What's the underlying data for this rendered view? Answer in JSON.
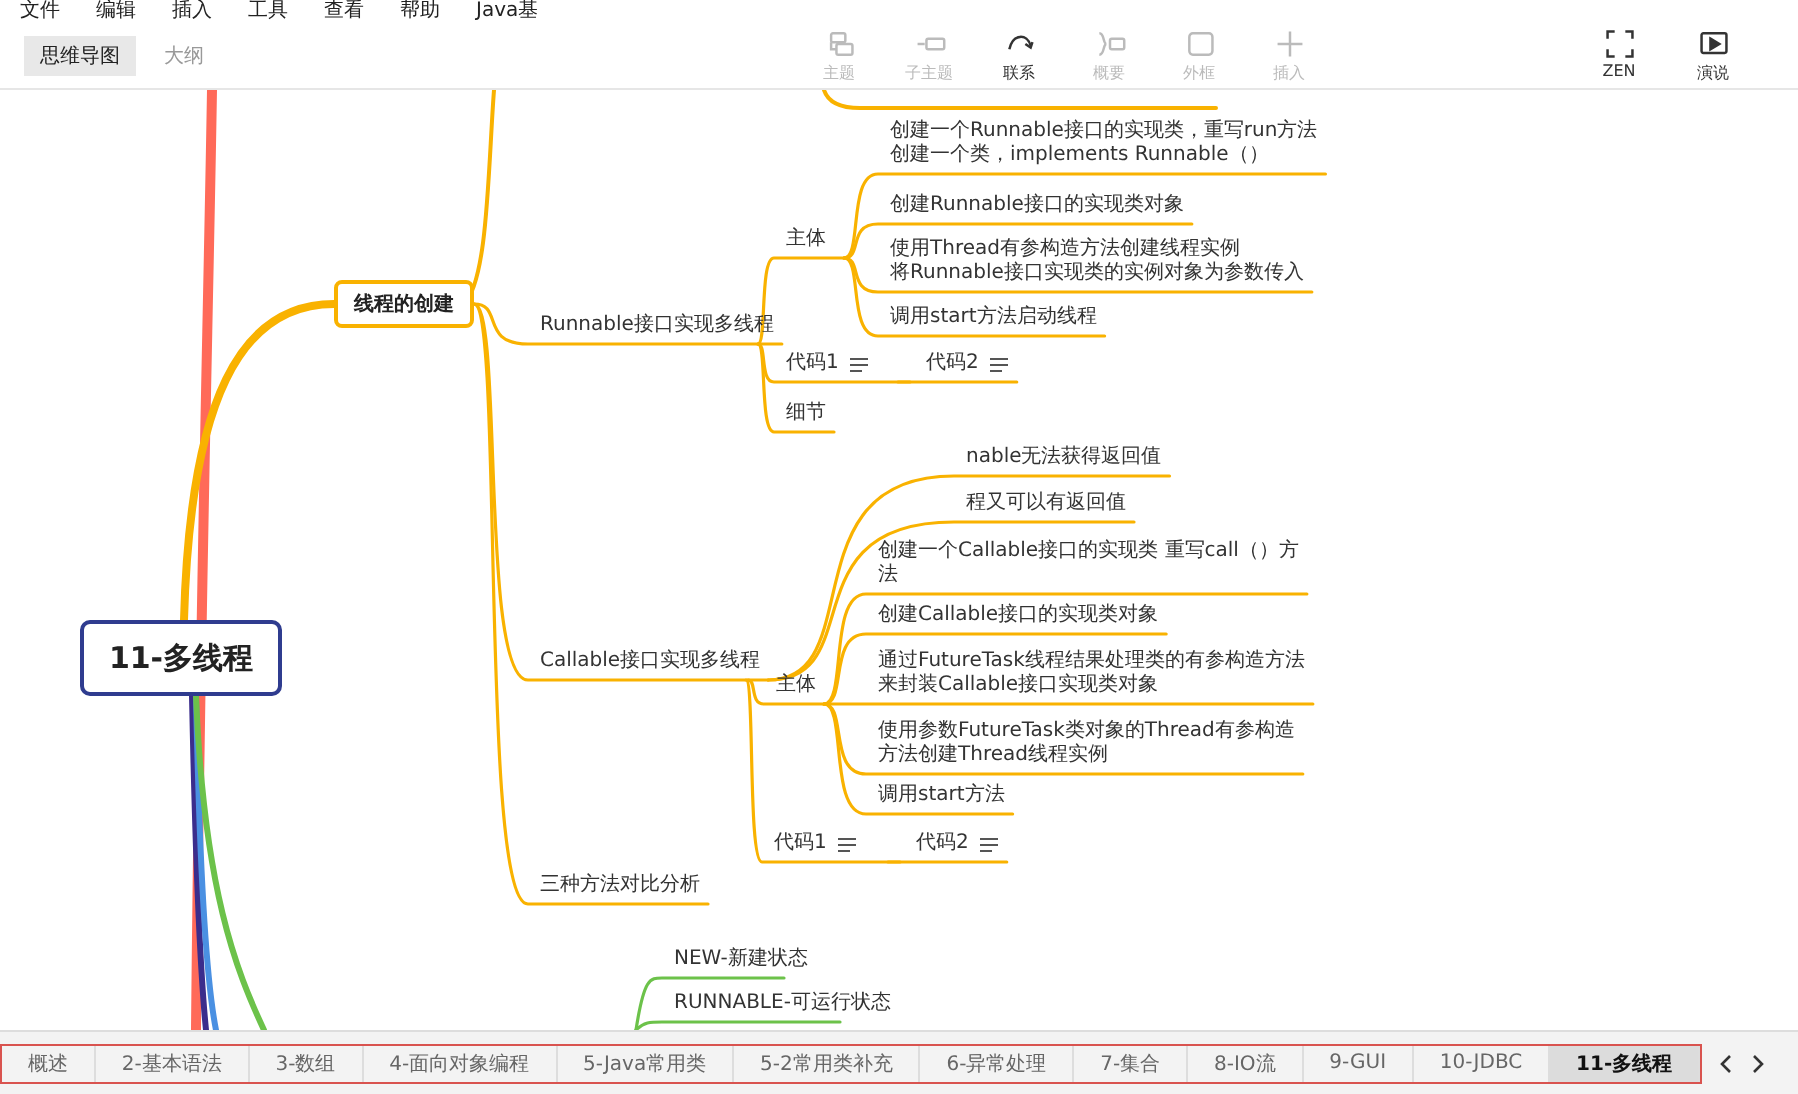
{
  "menu": [
    "文件",
    "编辑",
    "插入",
    "工具",
    "查看",
    "帮助",
    "Java基"
  ],
  "view_tabs": [
    {
      "label": "思维导图",
      "selected": true
    },
    {
      "label": "大纲",
      "selected": false
    }
  ],
  "toolbar": [
    {
      "label": "主题",
      "disabled": true
    },
    {
      "label": "子主题",
      "disabled": true
    },
    {
      "label": "联系",
      "disabled": false
    },
    {
      "label": "概要",
      "disabled": true
    },
    {
      "label": "外框",
      "disabled": true
    },
    {
      "label": "插入",
      "disabled": true
    }
  ],
  "toolbar_right": [
    {
      "label": "ZEN"
    },
    {
      "label": "演说"
    }
  ],
  "mind_map": {
    "root": {
      "label": "11-多线程",
      "children": [
        {
          "label": "线程的创建",
          "color": "#f9b200",
          "has_note": false,
          "children": [
            {
              "label": "Runnable接口实现多线程",
              "has_note": false,
              "children": [
                {
                  "label": "主体",
                  "has_note": false,
                  "children": [
                    {
                      "lines": [
                        "创建一个Runnable接口的实现类，重写run方法",
                        "创建一个类，implements Runnable（）"
                      ],
                      "has_note": false
                    },
                    {
                      "label": "创建Runnable接口的实现类对象",
                      "has_note": false
                    },
                    {
                      "lines": [
                        "使用Thread有参构造方法创建线程实例",
                        "将Runnable接口实现类的实例对象为参数传入"
                      ],
                      "has_note": false
                    },
                    {
                      "label": "调用start方法启动线程",
                      "has_note": false
                    }
                  ]
                },
                {
                  "label": "代码1",
                  "has_note": true,
                  "children": [
                    {
                      "label": "代码2",
                      "has_note": true
                    }
                  ]
                },
                {
                  "label": "细节",
                  "has_note": false
                }
              ]
            },
            {
              "label": "Callable接口实现多线程",
              "has_note": false,
              "children": [
                {
                  "label": "nable无法获得返回值",
                  "has_note": false
                },
                {
                  "label": "程又可以有返回值",
                  "has_note": false
                },
                {
                  "label": "主体",
                  "has_note": false,
                  "children": [
                    {
                      "lines": [
                        "创建一个Callable接口的实现类 重写call（）方",
                        "法"
                      ],
                      "has_note": false
                    },
                    {
                      "label": "创建Callable接口的实现类对象",
                      "has_note": false
                    },
                    {
                      "lines": [
                        "通过FutureTask线程结果处理类的有参构造方法",
                        "来封装Callable接口实现类对象"
                      ],
                      "has_note": false
                    },
                    {
                      "lines": [
                        "使用参数FutureTask类对象的Thread有参构造",
                        "方法创建Thread线程实例"
                      ],
                      "has_note": false
                    },
                    {
                      "label": "调用start方法",
                      "has_note": false
                    }
                  ]
                },
                {
                  "label": "代码1",
                  "has_note": true,
                  "children": [
                    {
                      "label": "代码2",
                      "has_note": true
                    }
                  ]
                }
              ]
            },
            {
              "label": "三种方法对比分析",
              "has_note": false
            }
          ]
        }
      ]
    },
    "partial_branch": {
      "color": "#6cc24a",
      "children": [
        {
          "label": "NEW-新建状态",
          "has_note": false
        },
        {
          "label": "RUNNABLE-可运行状态",
          "has_note": false
        }
      ]
    }
  },
  "sheet_tabs": [
    {
      "label": "概述",
      "selected": false
    },
    {
      "label": "2-基本语法",
      "selected": false
    },
    {
      "label": "3-数组",
      "selected": false
    },
    {
      "label": "4-面向对象编程",
      "selected": false
    },
    {
      "label": "5-Java常用类",
      "selected": false
    },
    {
      "label": "5-2常用类补充",
      "selected": false
    },
    {
      "label": "6-异常处理",
      "selected": false
    },
    {
      "label": "7-集合",
      "selected": false
    },
    {
      "label": "8-IO流",
      "selected": false
    },
    {
      "label": "9-GUI",
      "selected": false
    },
    {
      "label": "10-JDBC",
      "selected": false
    },
    {
      "label": "11-多线程",
      "selected": true
    }
  ]
}
